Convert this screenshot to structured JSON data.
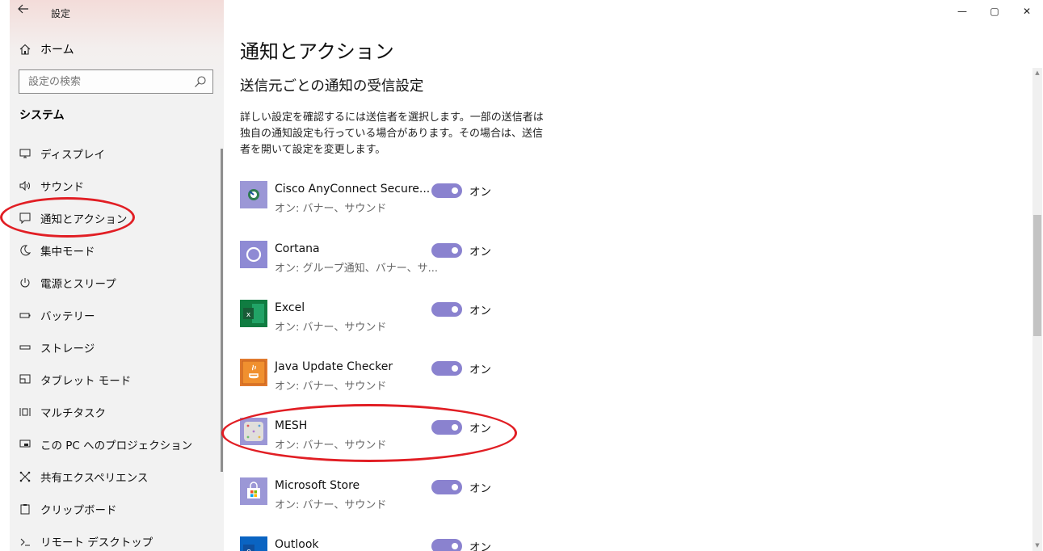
{
  "window": {
    "title": "設定",
    "controls": [
      "—",
      "▢",
      "✕"
    ]
  },
  "sidebar": {
    "home_label": "ホーム",
    "search_placeholder": "設定の検索",
    "section_title": "システム",
    "items": [
      {
        "label": "ディスプレイ",
        "icon": "display-icon"
      },
      {
        "label": "サウンド",
        "icon": "sound-icon"
      },
      {
        "label": "通知とアクション",
        "icon": "notification-icon"
      },
      {
        "label": "集中モード",
        "icon": "focus-assist-icon"
      },
      {
        "label": "電源とスリープ",
        "icon": "power-icon"
      },
      {
        "label": "バッテリー",
        "icon": "battery-icon"
      },
      {
        "label": "ストレージ",
        "icon": "storage-icon"
      },
      {
        "label": "タブレット モード",
        "icon": "tablet-mode-icon"
      },
      {
        "label": "マルチタスク",
        "icon": "multitasking-icon"
      },
      {
        "label": "この PC へのプロジェクション",
        "icon": "projecting-icon"
      },
      {
        "label": "共有エクスペリエンス",
        "icon": "shared-experiences-icon"
      },
      {
        "label": "クリップボード",
        "icon": "clipboard-icon"
      },
      {
        "label": "リモート デスクトップ",
        "icon": "remote-desktop-icon"
      }
    ]
  },
  "main": {
    "title": "通知とアクション",
    "subheading": "送信元ごとの通知の受信設定",
    "description": "詳しい設定を確認するには送信者を選択します。一部の送信者は独自の通知設定も行っている場合があります。その場合は、送信者を開いて設定を変更します。",
    "toggle_on_label": "オン",
    "apps": [
      {
        "name": "Cisco AnyConnect Secure...",
        "sub": "オン: バナー、サウンド",
        "icon": "cisco-anyconnect-icon",
        "on": true
      },
      {
        "name": "Cortana",
        "sub": "オン: グループ通知、バナー、サ...",
        "icon": "cortana-icon",
        "on": true
      },
      {
        "name": "Excel",
        "sub": "オン: バナー、サウンド",
        "icon": "excel-icon",
        "on": true
      },
      {
        "name": "Java Update Checker",
        "sub": "オン: バナー、サウンド",
        "icon": "java-icon",
        "on": true
      },
      {
        "name": "MESH",
        "sub": "オン: バナー、サウンド",
        "icon": "mesh-icon",
        "on": true
      },
      {
        "name": "Microsoft Store",
        "sub": "オン: バナー、サウンド",
        "icon": "microsoft-store-icon",
        "on": true
      },
      {
        "name": "Outlook",
        "sub": "",
        "icon": "outlook-icon",
        "on": true
      }
    ]
  },
  "colors": {
    "toggle_on": "#8a82cf",
    "highlight_circle": "#e11e24",
    "sidebar_bg": "#f2f2f2"
  }
}
